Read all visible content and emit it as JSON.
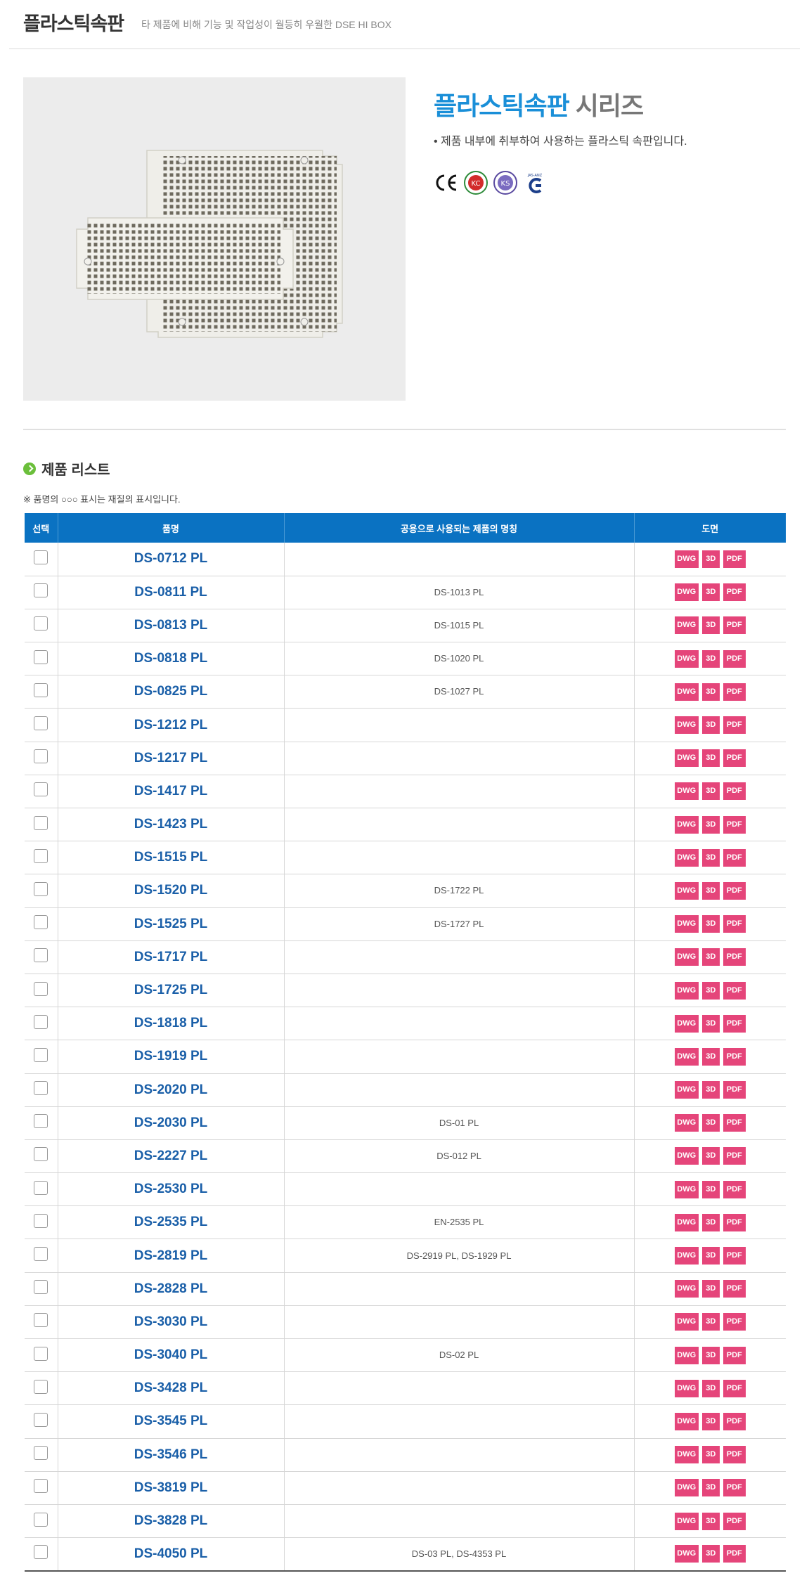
{
  "header": {
    "title": "플라스틱속판",
    "subtitle": "타 제품에 비해 기능 및 작업성이 월등히 우월한 DSE HI BOX"
  },
  "series": {
    "title_accent": "플라스틱속판",
    "title_rest": "시리즈",
    "description": "• 제품 내부에 취부하여 사용하는 플라스틱 속판입니다.",
    "certifications": [
      "CE",
      "KC",
      "KS",
      "JAS-ANZ"
    ]
  },
  "list": {
    "title": "제품 리스트",
    "note": "※ 품명의 ○○○ 표시는 재질의 표시입니다.",
    "columns": [
      "선택",
      "품명",
      "공용으로 사용되는 제품의 명칭",
      "도면"
    ],
    "buttons": {
      "dwg": "DWG",
      "d3": "3D",
      "pdf": "PDF"
    },
    "rows": [
      {
        "name": "DS-0712 PL",
        "compat": ""
      },
      {
        "name": "DS-0811 PL",
        "compat": "DS-1013 PL"
      },
      {
        "name": "DS-0813 PL",
        "compat": "DS-1015 PL"
      },
      {
        "name": "DS-0818 PL",
        "compat": "DS-1020 PL"
      },
      {
        "name": "DS-0825 PL",
        "compat": "DS-1027 PL"
      },
      {
        "name": "DS-1212 PL",
        "compat": ""
      },
      {
        "name": "DS-1217 PL",
        "compat": ""
      },
      {
        "name": "DS-1417 PL",
        "compat": ""
      },
      {
        "name": "DS-1423 PL",
        "compat": ""
      },
      {
        "name": "DS-1515 PL",
        "compat": ""
      },
      {
        "name": "DS-1520 PL",
        "compat": "DS-1722 PL"
      },
      {
        "name": "DS-1525 PL",
        "compat": "DS-1727 PL"
      },
      {
        "name": "DS-1717 PL",
        "compat": ""
      },
      {
        "name": "DS-1725 PL",
        "compat": ""
      },
      {
        "name": "DS-1818 PL",
        "compat": ""
      },
      {
        "name": "DS-1919 PL",
        "compat": ""
      },
      {
        "name": "DS-2020 PL",
        "compat": ""
      },
      {
        "name": "DS-2030 PL",
        "compat": "DS-01 PL"
      },
      {
        "name": "DS-2227 PL",
        "compat": "DS-012 PL"
      },
      {
        "name": "DS-2530 PL",
        "compat": ""
      },
      {
        "name": "DS-2535 PL",
        "compat": "EN-2535 PL"
      },
      {
        "name": "DS-2819 PL",
        "compat": "DS-2919 PL, DS-1929 PL"
      },
      {
        "name": "DS-2828 PL",
        "compat": ""
      },
      {
        "name": "DS-3030 PL",
        "compat": ""
      },
      {
        "name": "DS-3040 PL",
        "compat": "DS-02 PL"
      },
      {
        "name": "DS-3428 PL",
        "compat": ""
      },
      {
        "name": "DS-3545 PL",
        "compat": ""
      },
      {
        "name": "DS-3546 PL",
        "compat": ""
      },
      {
        "name": "DS-3819 PL",
        "compat": ""
      },
      {
        "name": "DS-3828 PL",
        "compat": ""
      },
      {
        "name": "DS-4050 PL",
        "compat": "DS-03 PL, DS-4353 PL"
      }
    ]
  },
  "colors": {
    "accent": "#1a8fd8",
    "table_header": "#0a72c2",
    "product_name": "#1a5fa8",
    "file_button": "#e5457a"
  }
}
